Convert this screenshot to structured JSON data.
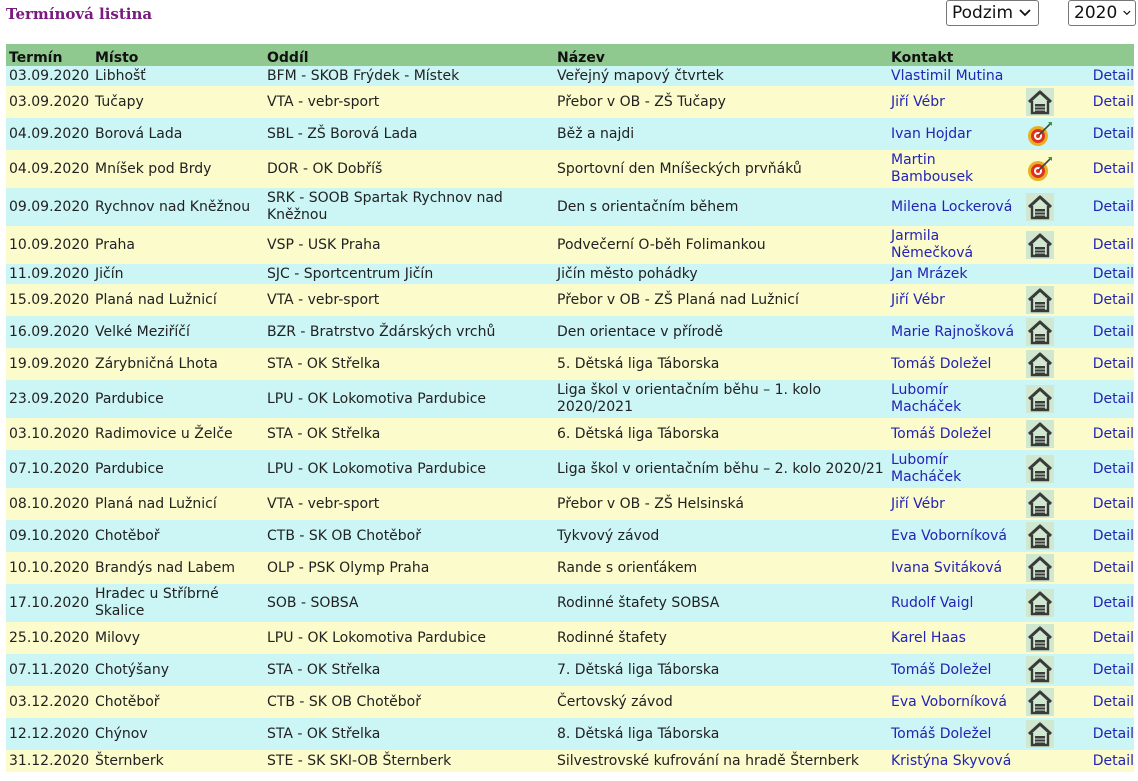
{
  "title": "Termínová listina",
  "filters": {
    "season": "Podzim",
    "year": "2020"
  },
  "table": {
    "headers": {
      "termin": "Termín",
      "misto": "Místo",
      "oddil": "Oddíl",
      "nazev": "Název",
      "kontakt": "Kontakt"
    },
    "detail_label": "Detail",
    "rows": [
      {
        "date": "03.09.2020",
        "place": "Libhošť",
        "club": "BFM - SKOB Frýdek - Místek",
        "name": "Veřejný mapový čtvrtek",
        "contact": "Vlastimil Mutina",
        "icon": "",
        "h": 20
      },
      {
        "date": "03.09.2020",
        "place": "Tučapy",
        "club": "VTA - vebr-sport",
        "name": "Přebor v OB - ZŠ Tučapy",
        "contact": "Jiří Vébr",
        "icon": "school",
        "h": 32
      },
      {
        "date": "04.09.2020",
        "place": "Borová Lada",
        "club": "SBL - ZŠ Borová Lada",
        "name": "Běž a najdi",
        "contact": "Ivan Hojdar",
        "icon": "target",
        "h": 32
      },
      {
        "date": "04.09.2020",
        "place": "Mníšek pod Brdy",
        "club": "DOR - OK Dobříš",
        "name": "Sportovní den Mníšeckých prvňáků",
        "contact": "Martin Bambousek",
        "icon": "target",
        "h": 38
      },
      {
        "date": "09.09.2020",
        "place": "Rychnov nad Kněžnou",
        "club": "SRK - SOOB Spartak Rychnov nad Kněžnou",
        "name": "Den s orientačním během",
        "contact": "Milena Lockerová",
        "icon": "school",
        "h": 38
      },
      {
        "date": "10.09.2020",
        "place": "Praha",
        "club": "VSP - USK Praha",
        "name": "Podvečerní O-běh Folimankou",
        "contact": "Jarmila Němečková",
        "icon": "school",
        "h": 38
      },
      {
        "date": "11.09.2020",
        "place": "Jičín",
        "club": "SJC - Sportcentrum Jičín",
        "name": "Jičín město pohádky",
        "contact": "Jan Mrázek",
        "icon": "",
        "h": 20
      },
      {
        "date": "15.09.2020",
        "place": "Planá nad Lužnicí",
        "club": "VTA - vebr-sport",
        "name": "Přebor v OB - ZŠ Planá nad Lužnicí",
        "contact": "Jiří Vébr",
        "icon": "school",
        "h": 32
      },
      {
        "date": "16.09.2020",
        "place": "Velké Meziříčí",
        "club": "BZR - Bratrstvo Ždárských vrchů",
        "name": "Den orientace v přírodě",
        "contact": "Marie Rajnošková",
        "icon": "school",
        "h": 32
      },
      {
        "date": "19.09.2020",
        "place": "Zárybničná Lhota",
        "club": "STA - OK Střelka",
        "name": "5. Dětská liga Táborska",
        "contact": "Tomáš Doležel",
        "icon": "school",
        "h": 32
      },
      {
        "date": "23.09.2020",
        "place": "Pardubice",
        "club": "LPU - OK Lokomotiva Pardubice",
        "name": "Liga škol v orientačním běhu – 1. kolo 2020/2021",
        "contact": "Lubomír Macháček",
        "icon": "school",
        "h": 38
      },
      {
        "date": "03.10.2020",
        "place": "Radimovice u Želče",
        "club": "STA - OK Střelka",
        "name": "6. Dětská liga Táborska",
        "contact": "Tomáš Doležel",
        "icon": "school",
        "h": 32
      },
      {
        "date": "07.10.2020",
        "place": "Pardubice",
        "club": "LPU - OK Lokomotiva Pardubice",
        "name": "Liga škol v orientačním běhu – 2. kolo 2020/21",
        "contact": "Lubomír Macháček",
        "icon": "school",
        "h": 38
      },
      {
        "date": "08.10.2020",
        "place": "Planá nad Lužnicí",
        "club": "VTA - vebr-sport",
        "name": "Přebor v OB - ZŠ Helsinská",
        "contact": "Jiří Vébr",
        "icon": "school",
        "h": 32
      },
      {
        "date": "09.10.2020",
        "place": "Chotěboř",
        "club": "CTB - SK OB Chotěboř",
        "name": "Tykvový závod",
        "contact": "Eva Voborníková",
        "icon": "school",
        "h": 32
      },
      {
        "date": "10.10.2020",
        "place": "Brandýs nad Labem",
        "club": "OLP - PSK Olymp Praha",
        "name": "Rande s orienťákem",
        "contact": "Ivana Svitáková",
        "icon": "school",
        "h": 32
      },
      {
        "date": "17.10.2020",
        "place": "Hradec u Stříbrné Skalice",
        "club": "SOB - SOBSA",
        "name": "Rodinné štafety SOBSA",
        "contact": "Rudolf Vaigl",
        "icon": "school",
        "h": 38
      },
      {
        "date": "25.10.2020",
        "place": "Milovy",
        "club": "LPU - OK Lokomotiva Pardubice",
        "name": "Rodinné štafety",
        "contact": "Karel Haas",
        "icon": "school",
        "h": 32
      },
      {
        "date": "07.11.2020",
        "place": "Chotýšany",
        "club": "STA - OK Střelka",
        "name": "7. Dětská liga Táborska",
        "contact": "Tomáš Doležel",
        "icon": "school",
        "h": 32
      },
      {
        "date": "03.12.2020",
        "place": "Chotěboř",
        "club": "CTB - SK OB Chotěboř",
        "name": "Čertovský závod",
        "contact": "Eva Voborníková",
        "icon": "school",
        "h": 32
      },
      {
        "date": "12.12.2020",
        "place": "Chýnov",
        "club": "STA - OK Střelka",
        "name": "8. Dětská liga Táborska",
        "contact": "Tomáš Doležel",
        "icon": "school",
        "h": 32
      },
      {
        "date": "31.12.2020",
        "place": "Šternberk",
        "club": "STE - SK SKI-OB Šternberk",
        "name": "Silvestrovské kufrování na hradě Šternberk",
        "contact": "Kristýna Skyvová",
        "icon": "",
        "h": 22
      }
    ]
  }
}
